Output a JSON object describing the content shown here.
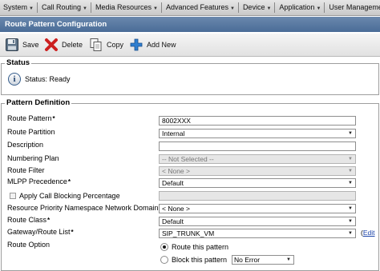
{
  "menubar": {
    "items": [
      {
        "label": "System"
      },
      {
        "label": "Call Routing"
      },
      {
        "label": "Media Resources"
      },
      {
        "label": "Advanced Features"
      },
      {
        "label": "Device"
      },
      {
        "label": "Application"
      },
      {
        "label": "User Management"
      }
    ]
  },
  "page": {
    "title": "Route Pattern Configuration"
  },
  "toolbar": {
    "save_label": "Save",
    "delete_label": "Delete",
    "copy_label": "Copy",
    "add_new_label": "Add New"
  },
  "status": {
    "legend": "Status",
    "message": "Status: Ready"
  },
  "pattern_definition": {
    "legend": "Pattern Definition",
    "route_pattern": {
      "label": "Route Pattern",
      "value": "8002XXX"
    },
    "route_partition": {
      "label": "Route Partition",
      "value": "Internal"
    },
    "description": {
      "label": "Description",
      "value": ""
    },
    "numbering_plan": {
      "label": "Numbering Plan",
      "value": "-- Not Selected --"
    },
    "route_filter": {
      "label": "Route Filter",
      "value": "< None >"
    },
    "mlpp_precedence": {
      "label": "MLPP Precedence",
      "value": "Default"
    },
    "call_blocking": {
      "label": "Apply Call Blocking Percentage",
      "value": ""
    },
    "resource_priority": {
      "label": "Resource Priority Namespace Network Domain",
      "value": "< None >"
    },
    "route_class": {
      "label": "Route Class",
      "value": "Default"
    },
    "gateway_route_list": {
      "label": "Gateway/Route List",
      "value": "SIP_TRUNK_VM",
      "edit_open": "(",
      "edit_label": "Edit"
    },
    "route_option": {
      "label": "Route Option",
      "route_this_pattern": "Route this pattern",
      "block_this_pattern": "Block this pattern",
      "block_reason": "No Error"
    }
  },
  "colors": {
    "title_bar": "#5a7aa3",
    "link": "#1b43a8",
    "delete_icon": "#cc1f1f",
    "add_icon": "#2f7fd0"
  }
}
